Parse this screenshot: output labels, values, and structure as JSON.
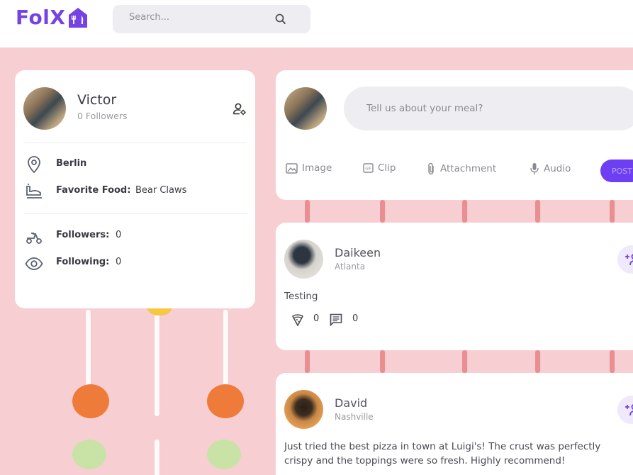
{
  "brand": {
    "name": "FolX",
    "color": "#7543e3",
    "icon": "food-house-icon"
  },
  "search": {
    "placeholder": "Search...",
    "icon": "search-icon"
  },
  "profile": {
    "name": "Victor",
    "followers_text": "0 Followers",
    "location": "Berlin",
    "favorite_food_label": "Favorite Food:",
    "favorite_food": "Bear Claws",
    "followers_label": "Followers:",
    "followers_count": "0",
    "following_label": "Following:",
    "following_count": "0"
  },
  "composer": {
    "placeholder": "Tell us about your meal?",
    "tools": [
      "Image",
      "Clip",
      "Attachment",
      "Audio"
    ],
    "post_label": "POST",
    "accent": "#6e3ff2"
  },
  "posts": [
    {
      "author": "Daikeen",
      "location": "Atlanta",
      "text": "Testing",
      "likes": "0",
      "comments": "0"
    },
    {
      "author": "David",
      "location": "Nashville",
      "text": "Just tried the best pizza in town at Luigi's! The crust was perfectly crispy and the toppings were so fresh. Highly recommend!"
    }
  ]
}
